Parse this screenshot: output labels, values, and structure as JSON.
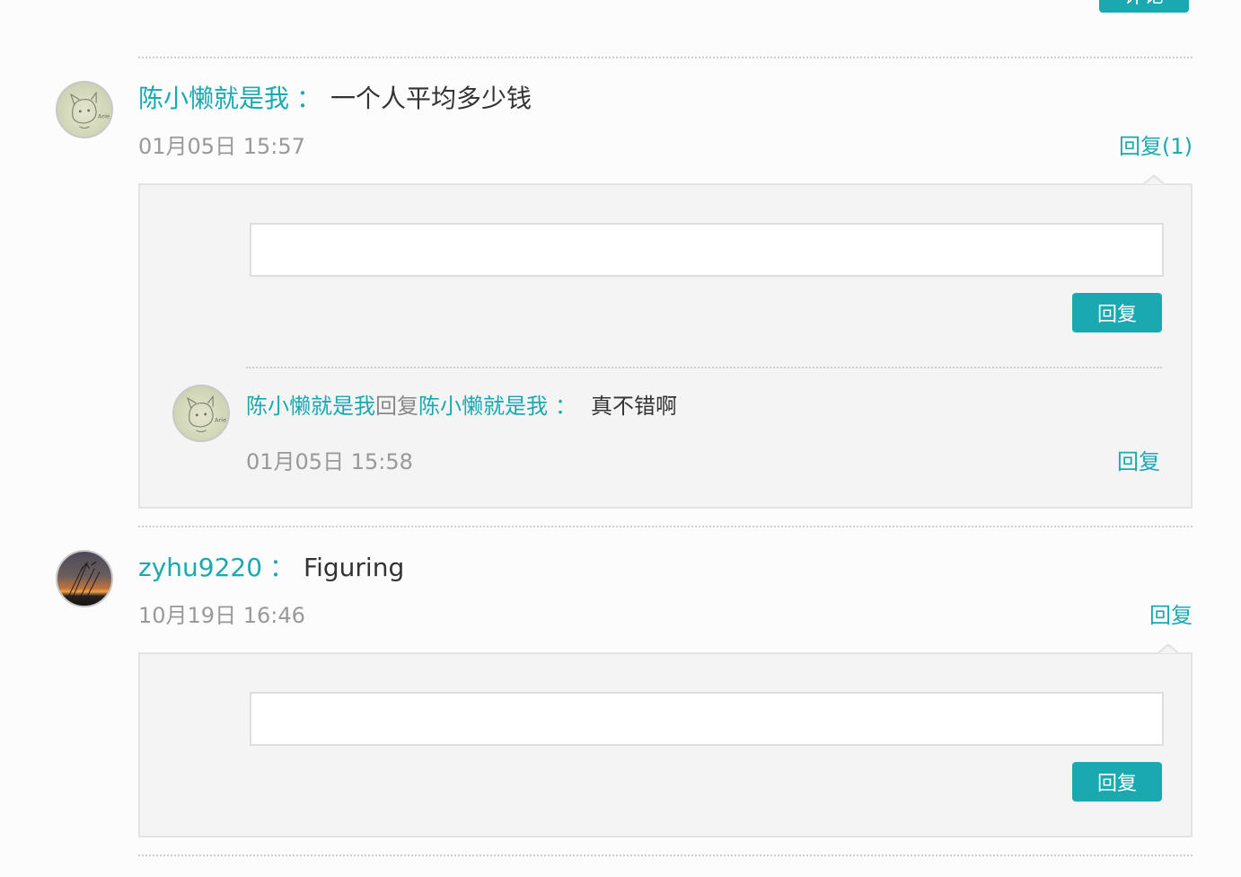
{
  "top": {
    "button_label": "评论"
  },
  "comments": [
    {
      "username": "陈小懒就是我",
      "colon": "：",
      "text": "一个人平均多少钱",
      "time": "01月05日 15:57",
      "reply_label": "回复(1)",
      "avatar_icon": "sketch-avatar",
      "reply_box": {
        "input_value": "",
        "submit_label": "回复",
        "replies": [
          {
            "from_user": "陈小懒就是我",
            "reply_word": "回复",
            "to_user": "陈小懒就是我",
            "colon": "：",
            "text": "真不错啊",
            "time": "01月05日 15:58",
            "reply_label": "回复",
            "avatar_icon": "sketch-avatar"
          }
        ]
      }
    },
    {
      "username": "zyhu9220",
      "colon": "：",
      "text": "Figuring",
      "time": "10月19日 16:46",
      "reply_label": "回复",
      "avatar_icon": "sunset-avatar",
      "reply_box": {
        "input_value": "",
        "submit_label": "回复",
        "replies": []
      }
    }
  ],
  "colors": {
    "accent": "#1ba9b1",
    "text": "#333333",
    "muted": "#999999",
    "panel": "#f4f4f4"
  }
}
